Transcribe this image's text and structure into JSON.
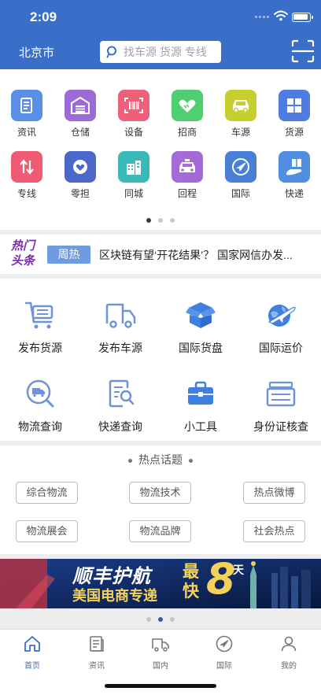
{
  "status_bar": {
    "time": "2:09"
  },
  "topbar": {
    "city": "北京市",
    "search_placeholder": "找车源 货源 专线"
  },
  "grid": [
    {
      "label": "资讯",
      "icon": "news-icon",
      "color": "#5a8fe8"
    },
    {
      "label": "仓储",
      "icon": "warehouse-icon",
      "color": "#9c6bd6"
    },
    {
      "label": "设备",
      "icon": "barcode-icon",
      "color": "#ee5f7a"
    },
    {
      "label": "招商",
      "icon": "handshake-icon",
      "color": "#4fcf72"
    },
    {
      "label": "车源",
      "icon": "car-icon",
      "color": "#c6cf2f"
    },
    {
      "label": "货源",
      "icon": "goods-icon",
      "color": "#4f7ce0"
    },
    {
      "label": "专线",
      "icon": "route-icon",
      "color": "#ef5b73"
    },
    {
      "label": "零担",
      "icon": "heart-box-icon",
      "color": "#4a67c9"
    },
    {
      "label": "同城",
      "icon": "city-icon",
      "color": "#3ab9b9"
    },
    {
      "label": "回程",
      "icon": "taxi-icon",
      "color": "#a46bd8"
    },
    {
      "label": "国际",
      "icon": "plane-icon",
      "color": "#4a7fd8"
    },
    {
      "label": "快递",
      "icon": "courier-icon",
      "color": "#4f8ee0"
    }
  ],
  "headline": {
    "hot_line1": "热门",
    "hot_line2": "头条",
    "tag": "周热",
    "title": "区块链有望‘开花结果’？ 国家网信办发..."
  },
  "services": [
    {
      "label": "发布货源",
      "icon": "cart-icon"
    },
    {
      "label": "发布车源",
      "icon": "truck-icon"
    },
    {
      "label": "国际货盘",
      "icon": "box-open-icon"
    },
    {
      "label": "国际运价",
      "icon": "globe-plane-icon"
    },
    {
      "label": "物流查询",
      "icon": "truck-search-icon"
    },
    {
      "label": "快递查询",
      "icon": "doc-search-icon"
    },
    {
      "label": "小工具",
      "icon": "toolbox-icon"
    },
    {
      "label": "身份证核查",
      "icon": "id-card-icon"
    }
  ],
  "topics": {
    "title": "热点话题",
    "chips": [
      "综合物流",
      "物流技术",
      "热点微博",
      "物流展会",
      "物流品牌",
      "社会热点"
    ]
  },
  "banner": {
    "line1": "顺丰护航",
    "line2": "美国电商专递",
    "fast": "最快",
    "days": "8",
    "day_unit": "天"
  },
  "tabs": [
    {
      "label": "首页",
      "icon": "home-icon",
      "active": true
    },
    {
      "label": "资讯",
      "icon": "news-tab-icon",
      "active": false
    },
    {
      "label": "国内",
      "icon": "truck-tab-icon",
      "active": false
    },
    {
      "label": "国际",
      "icon": "plane-tab-icon",
      "active": false
    },
    {
      "label": "我的",
      "icon": "user-icon",
      "active": false
    }
  ],
  "colors": {
    "brand": "#3a6fc9",
    "hot": "#7a2bb4",
    "tag": "#6f9be0"
  }
}
